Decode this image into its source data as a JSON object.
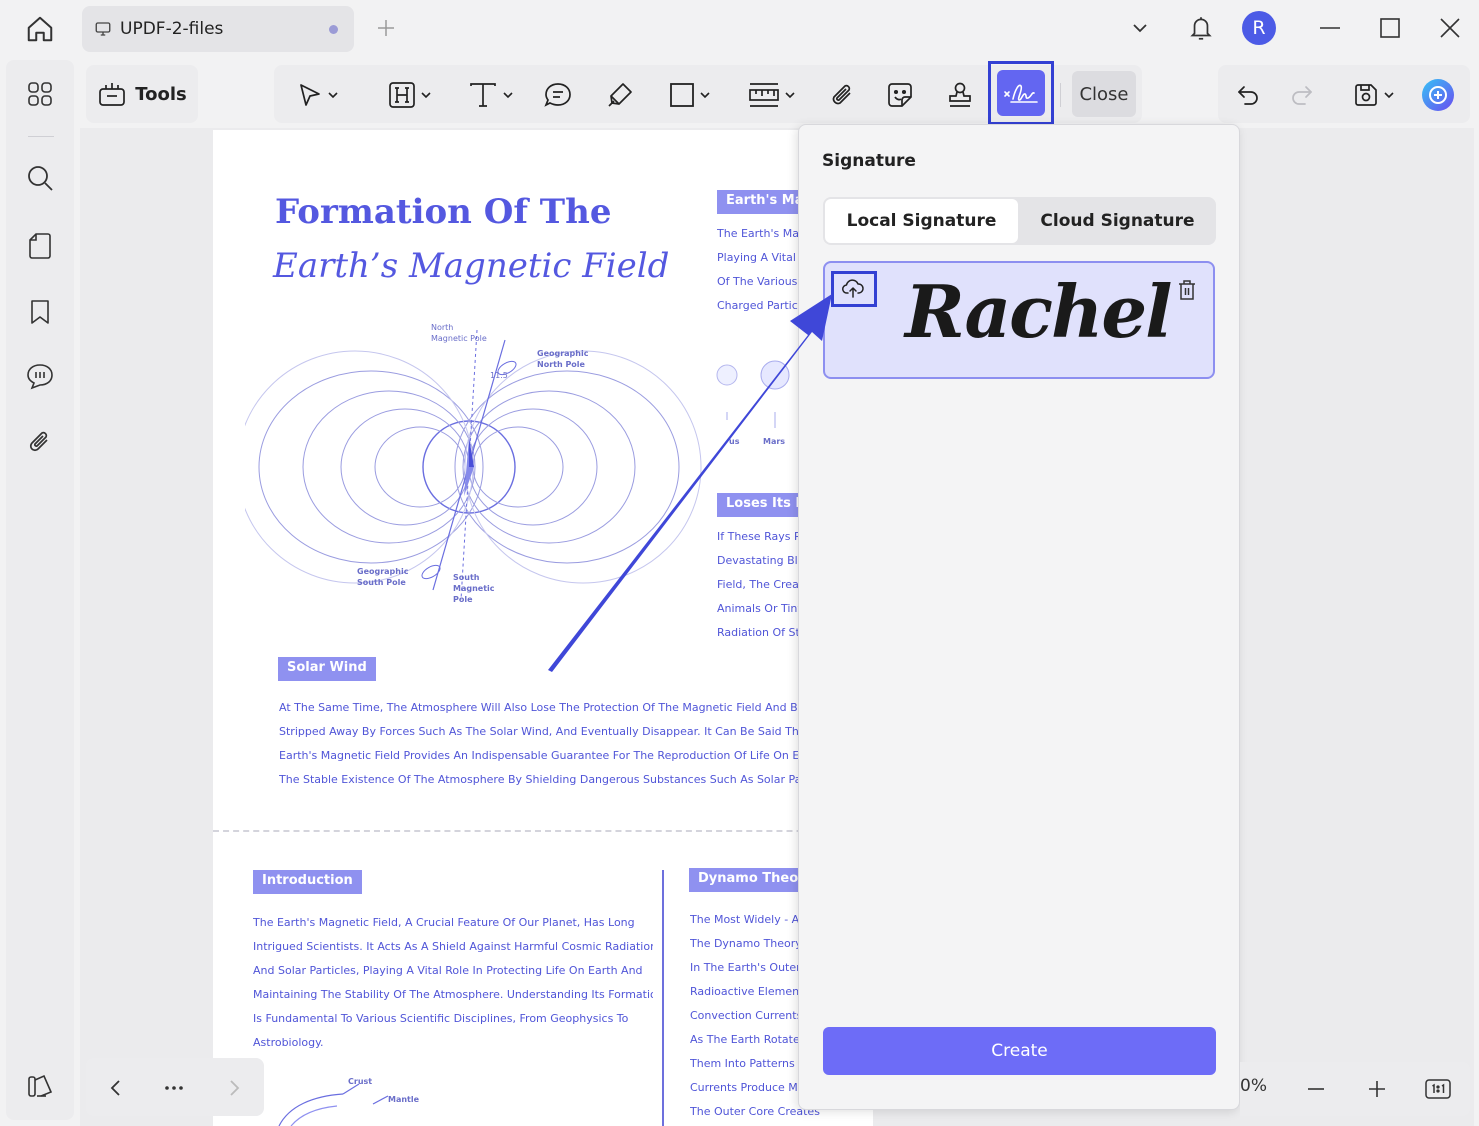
{
  "titlebar": {
    "tab_title": "UPDF-2-files",
    "user_initial": "R"
  },
  "toolbar": {
    "tools_label": "Tools",
    "close_label": "Close"
  },
  "document": {
    "title_line1": "Formation Of The",
    "title_line2": "Earth’s Magnetic Field",
    "diagram_labels": {
      "north_magnetic": "North\nMagnetic Pole",
      "geographic_north": "Geographic\nNorth Pole",
      "angle": "11.5",
      "geographic_south": "Geographic\nSouth Pole",
      "south_magnetic": "South\nMagnetic\nPole",
      "planet_partial": "us",
      "mars": "Mars"
    },
    "earths_ma_header": "Earth's Ma",
    "earths_ma_lines": [
      "The Earth's Mag",
      "Playing A Vital F",
      "Of The Various",
      "Charged Particle"
    ],
    "loses_header": "Loses Its M",
    "loses_lines": [
      "If These Rays R",
      "Devastating Blo",
      "Field, The Creat",
      "Animals Or Tiny",
      "Radiation Of Str"
    ],
    "solar_wind_header": "Solar Wind",
    "solar_wind_lines": [
      "At The Same Time, The Atmosphere Will Also Lose The Protection Of The Magnetic Field And Be Gradu",
      "Stripped Away By Forces Such As The Solar Wind, And Eventually Disappear. It Can Be Said That The",
      "Earth's Magnetic Field Provides An Indispensable Guarantee For The Reproduction Of Life On Earth And",
      "The Stable Existence Of The Atmosphere By Shielding Dangerous Substances Such As Solar Particles."
    ],
    "intro_header": "Introduction",
    "intro_lines": [
      "The Earth's Magnetic Field, A Crucial Feature Of Our Planet, Has Long",
      "Intrigued Scientists. It Acts As A Shield Against Harmful Cosmic Radiation",
      "And Solar Particles, Playing A Vital Role In Protecting Life On Earth And",
      "Maintaining The Stability Of The Atmosphere. Understanding Its Formation",
      "Is Fundamental To Various Scientific Disciplines, From Geophysics To",
      "Astrobiology."
    ],
    "dynamo_header": "Dynamo Theor",
    "dynamo_lines": [
      "The Most Widely - Ac",
      "The Dynamo Theory.",
      "In The Earth's Outer C",
      "Radioactive Elements",
      "Convection Currents",
      "As The Earth Rotates",
      "Them Into Patterns Th",
      "Currents Produce Ma",
      "The Outer Core Creates"
    ],
    "crust_label": "Crust",
    "mantle_label": "Mantle"
  },
  "signature_panel": {
    "title": "Signature",
    "tab_local": "Local Signature",
    "tab_cloud": "Cloud Signature",
    "signature_text": "Rachel",
    "create_label": "Create"
  },
  "zoom": {
    "value": "0%"
  },
  "colors": {
    "accent": "#6366f1",
    "highlight_outline": "#3340d3",
    "doc_text": "#5055d8"
  }
}
